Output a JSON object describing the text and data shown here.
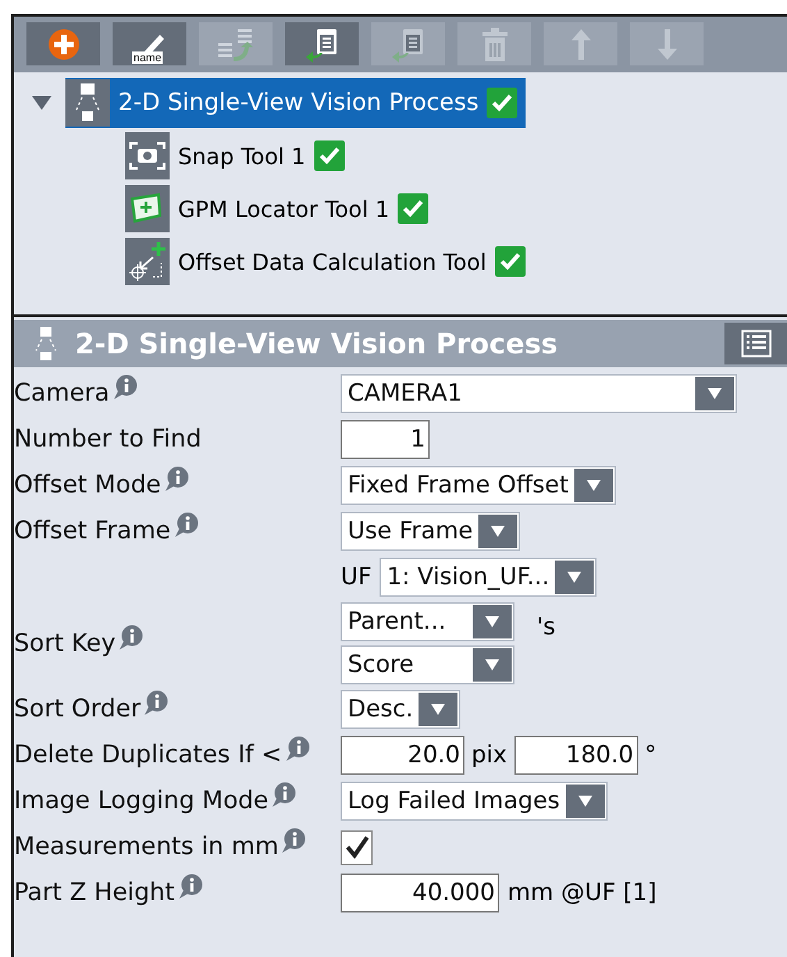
{
  "toolbar": {
    "buttons": [
      {
        "kind": "add",
        "disabled": false
      },
      {
        "kind": "rename",
        "label": "name",
        "disabled": false
      },
      {
        "kind": "copy",
        "disabled": true
      },
      {
        "kind": "paste",
        "disabled": false
      },
      {
        "kind": "insert",
        "disabled": true
      },
      {
        "kind": "delete",
        "disabled": true
      },
      {
        "kind": "up",
        "disabled": true
      },
      {
        "kind": "down",
        "disabled": true
      }
    ]
  },
  "tree": {
    "root": {
      "label": "2-D Single-View Vision Process",
      "expanded": true,
      "selected": true,
      "ok": true,
      "children": [
        {
          "kind": "snap",
          "label": "Snap Tool 1",
          "ok": true,
          "selected": false
        },
        {
          "kind": "locator",
          "label": "GPM Locator Tool 1",
          "ok": true,
          "selected": false
        },
        {
          "kind": "offset",
          "label": "Offset Data Calculation Tool",
          "ok": true,
          "selected": false
        }
      ]
    }
  },
  "header": {
    "title": "2-D Single-View Vision Process"
  },
  "form": {
    "rows": [
      {
        "label": "Camera",
        "info": true,
        "controls": [
          {
            "kind": "select",
            "value": "CAMERA1"
          }
        ]
      },
      {
        "label": "Number to Find",
        "info": false,
        "controls": [
          {
            "kind": "number",
            "value": "1"
          }
        ]
      },
      {
        "label": "Offset Mode",
        "info": true,
        "controls": [
          {
            "kind": "select",
            "value": "Fixed Frame Offset"
          }
        ]
      },
      {
        "label": "Offset Frame",
        "info": true,
        "controls": [
          {
            "kind": "select",
            "value": "Use Frame"
          }
        ]
      },
      {
        "info": false,
        "controls": [
          {
            "kind": "text",
            "value": "UF"
          },
          {
            "kind": "select",
            "value": "1: Vision_UF..."
          }
        ]
      },
      {
        "label": "Sort Key",
        "info": true,
        "controls": [
          {
            "kind": "stack",
            "values": [
              "Parent...",
              "Score"
            ]
          },
          {
            "kind": "text",
            "value": "'s"
          }
        ]
      },
      {
        "label": "Sort Order",
        "info": true,
        "controls": [
          {
            "kind": "select",
            "value": "Desc."
          }
        ]
      },
      {
        "label": "Delete Duplicates If <",
        "info": true,
        "controls": [
          {
            "kind": "number",
            "value": "20.0"
          },
          {
            "kind": "text",
            "value": "pix"
          },
          {
            "kind": "number",
            "value": "180.0"
          },
          {
            "kind": "text",
            "value": "°"
          }
        ]
      },
      {
        "label": "Image Logging Mode",
        "info": true,
        "controls": [
          {
            "kind": "select",
            "value": "Log Failed Images"
          }
        ]
      },
      {
        "label": "Measurements in mm",
        "info": true,
        "controls": [
          {
            "kind": "checkbox",
            "checked": true
          }
        ]
      },
      {
        "label": "Part Z Height",
        "info": true,
        "controls": [
          {
            "kind": "number",
            "value": "40.000"
          },
          {
            "kind": "text",
            "value": "mm @UF [1]"
          }
        ]
      }
    ]
  }
}
